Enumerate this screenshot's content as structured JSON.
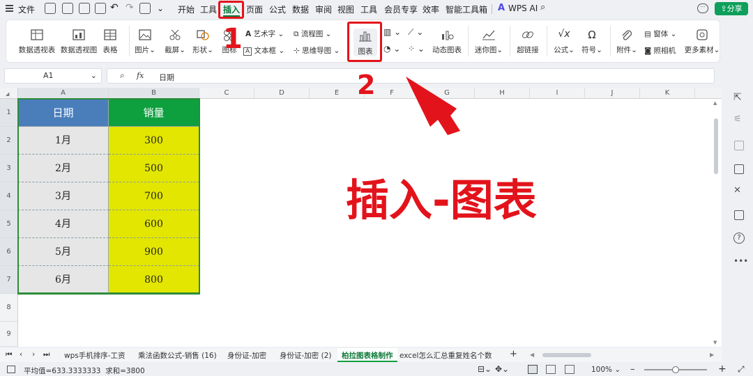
{
  "menu": {
    "file_label": "文件",
    "tabs": [
      "开始",
      "工具",
      "插入",
      "页面",
      "公式",
      "数据",
      "审阅",
      "视图",
      "工具",
      "会员专享",
      "效率",
      "智能工具箱"
    ],
    "wps_ai": "WPS AI",
    "share": "分享"
  },
  "ribbon": {
    "pivot_table": "数据透视表",
    "pivot_chart": "数据透视图",
    "table": "表格",
    "picture": "图片",
    "screenshot": "截屏",
    "shapes": "形状",
    "icons": "图标",
    "art_text": "艺术字",
    "text_box": "文本框",
    "flowchart": "流程图",
    "mindmap": "思维导图",
    "chart": "图表",
    "dynamic_chart": "动态图表",
    "sparkline": "迷你图",
    "hyperlink": "超链接",
    "formula": "公式",
    "symbol": "符号",
    "attachment": "附件",
    "form": "窗体",
    "camera": "照相机",
    "more": "更多素材"
  },
  "formula_bar": {
    "name_box": "A1",
    "fx": "fx",
    "content": "日期"
  },
  "columns": [
    "A",
    "B",
    "C",
    "D",
    "E",
    "F",
    "G",
    "H",
    "I",
    "J",
    "K"
  ],
  "rows": [
    "1",
    "2",
    "3",
    "4",
    "5",
    "6",
    "7",
    "8",
    "9"
  ],
  "table": {
    "headers": [
      "日期",
      "销量"
    ],
    "rows": [
      [
        "1月",
        "300"
      ],
      [
        "2月",
        "500"
      ],
      [
        "3月",
        "700"
      ],
      [
        "4月",
        "600"
      ],
      [
        "5月",
        "900"
      ],
      [
        "6月",
        "800"
      ]
    ]
  },
  "colors": {
    "header_date": "#4a7ebb",
    "header_sales": "#0e9f3f",
    "sales_fill": "#e2e600",
    "date_fill": "#e6e6e6",
    "annotation_red": "#e3131b"
  },
  "annotation": {
    "step1": "1",
    "step2": "2",
    "caption": "插入-图表"
  },
  "sheet_tabs": [
    "wps手机排序-工资",
    "乘法函数公式-销售 (16)",
    "身份证-加密",
    "身份证-加密 (2)",
    "柏拉图表格制作",
    "excel怎么汇总重复姓名个数"
  ],
  "active_sheet": "柏拉图表格制作",
  "status": {
    "summary": "平均值=633.3333333  求和=3800",
    "zoom": "100%"
  }
}
